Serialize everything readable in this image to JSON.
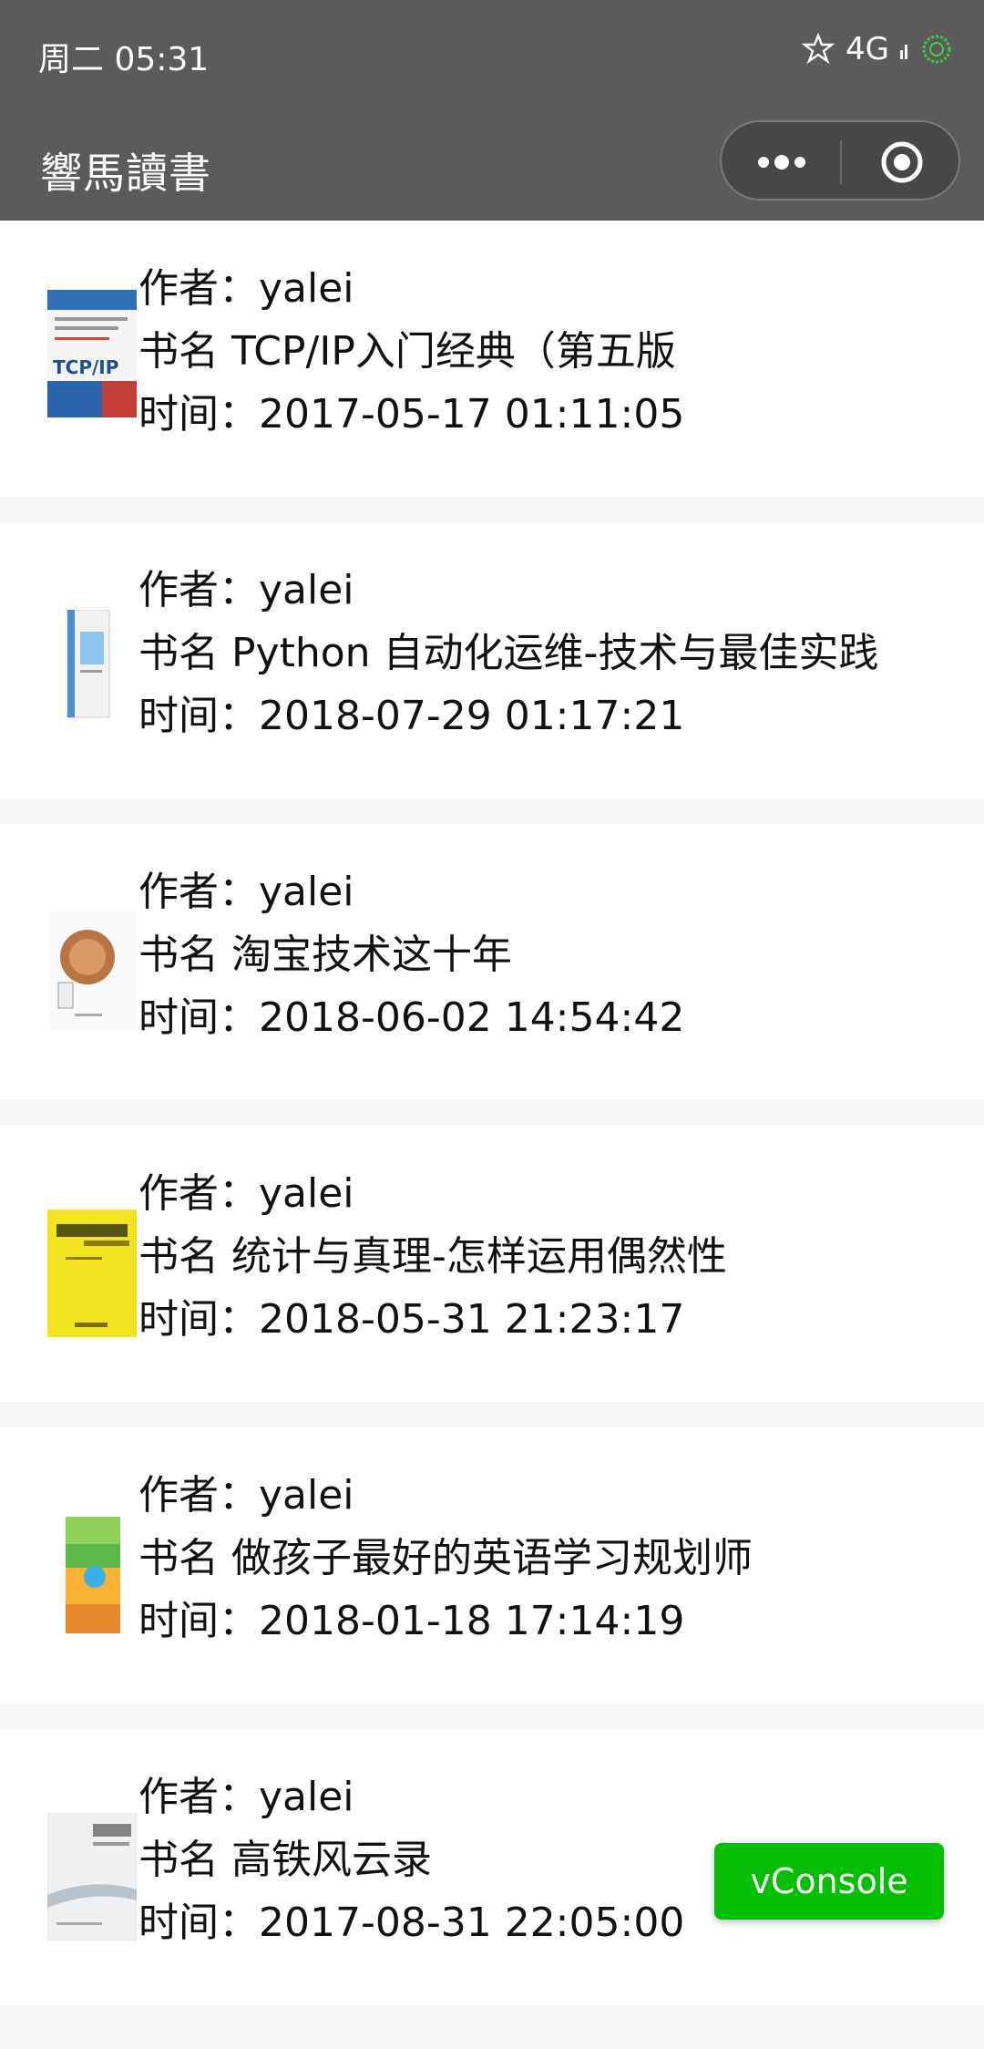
{
  "status_bar": {
    "time": "周二 05:31",
    "network": "4G"
  },
  "nav": {
    "title": "響馬讀書",
    "more_icon": "more-dots-icon",
    "close_icon": "target-circle-icon"
  },
  "labels": {
    "author": "作者：",
    "book": "书名 ",
    "time": "时间："
  },
  "books": [
    {
      "author": "yalei",
      "title": "TCP/IP入门经典（第五版",
      "time": "2017-05-17 01:11:05",
      "cover": "cover-tcpip"
    },
    {
      "author": "yalei",
      "title": "Python 自动化运维-技术与最佳实践",
      "time": "2018-07-29 01:17:21",
      "cover": "cover-python"
    },
    {
      "author": "yalei",
      "title": "淘宝技术这十年",
      "time": "2018-06-02 14:54:42",
      "cover": "cover-taobao"
    },
    {
      "author": "yalei",
      "title": "统计与真理-怎样运用偶然性",
      "time": "2018-05-31 21:23:17",
      "cover": "cover-statistics"
    },
    {
      "author": "yalei",
      "title": "做孩子最好的英语学习规划师",
      "time": "2018-01-18 17:14:19",
      "cover": "cover-english"
    },
    {
      "author": "yalei",
      "title": "高铁风云录",
      "time": "2017-08-31 22:05:00",
      "cover": "cover-railway"
    }
  ],
  "vconsole": {
    "label": "vConsole"
  },
  "colors": {
    "bar": "#5b5b5b",
    "accent": "#04be02",
    "background": "#f6f6f6"
  }
}
